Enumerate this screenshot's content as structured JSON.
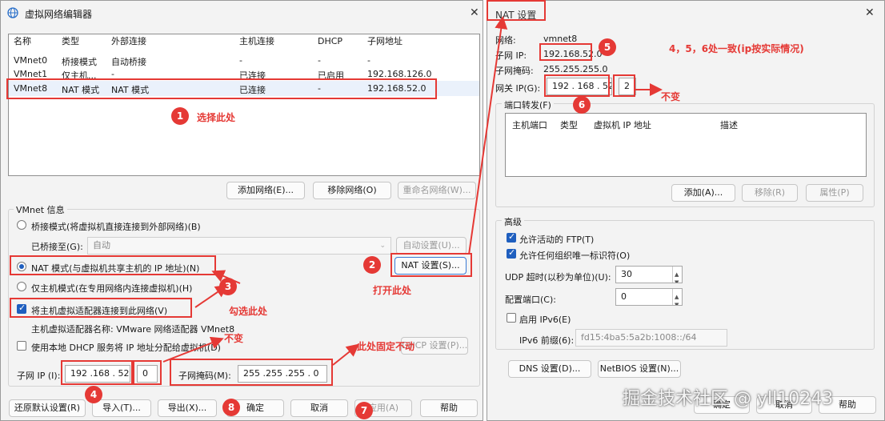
{
  "main_window": {
    "title": "虚拟网络编辑器",
    "close": "✕",
    "table": {
      "columns": [
        "名称",
        "类型",
        "外部连接",
        "主机连接",
        "DHCP",
        "子网地址"
      ],
      "rows": [
        {
          "name": "VMnet0",
          "type": "桥接模式",
          "ext": "自动桥接",
          "host": "-",
          "dhcp": "-",
          "subnet": "-"
        },
        {
          "name": "VMnet1",
          "type": "仅主机...",
          "ext": "-",
          "host": "已连接",
          "dhcp": "已启用",
          "subnet": "192.168.126.0"
        },
        {
          "name": "VMnet8",
          "type": "NAT 模式",
          "ext": "NAT 模式",
          "host": "已连接",
          "dhcp": "-",
          "subnet": "192.168.52.0"
        }
      ]
    },
    "buttons": {
      "add_network": "添加网络(E)...",
      "remove_network": "移除网络(O)",
      "rename_network": "重命名网络(W)...",
      "auto_settings": "自动设置(U)...",
      "nat_settings": "NAT 设置(S)...",
      "dhcp_settings": "DHCP 设置(P)...",
      "restore_defaults": "还原默认设置(R)",
      "import": "导入(T)...",
      "export": "导出(X)...",
      "ok": "确定",
      "cancel": "取消",
      "apply": "应用(A)",
      "help": "帮助"
    },
    "vmnet_info": {
      "legend": "VMnet 信息",
      "bridge_mode": "桥接模式(将虚拟机直接连接到外部网络)(B)",
      "bridged_to_label": "已桥接至(G):",
      "bridged_to_value": "自动",
      "nat_mode": "NAT 模式(与虚拟机共享主机的 IP 地址)(N)",
      "host_only_mode": "仅主机模式(在专用网络内连接虚拟机)(H)",
      "connect_adapter": "将主机虚拟适配器连接到此网络(V)",
      "adapter_name": "主机虚拟适配器名称: VMware 网络适配器 VMnet8",
      "use_dhcp": "使用本地 DHCP 服务将 IP 地址分配给虚拟机(D)",
      "subnet_ip_label": "子网 IP (I):",
      "subnet_ip_value": "192 .168 . 52",
      "subnet_ip_last": "0",
      "subnet_mask_label": "子网掩码(M):",
      "subnet_mask_value": "255 .255 .255 .  0"
    }
  },
  "nat_dialog": {
    "title": "NAT 设置",
    "close": "✕",
    "network_label": "网络:",
    "network_value": "vmnet8",
    "subnet_ip_label": "子网 IP:",
    "subnet_ip_value": "192.168.52.0",
    "subnet_mask_label": "子网掩码:",
    "subnet_mask_value": "255.255.255.0",
    "gateway_label": "网关 IP(G):",
    "gateway_value": "192 . 168 . 52",
    "gateway_last": "2",
    "port_forward_legend": "端口转发(F)",
    "port_columns": [
      "主机端口",
      "类型",
      "虚拟机 IP 地址",
      "描述"
    ],
    "buttons": {
      "add": "添加(A)...",
      "remove": "移除(R)",
      "properties": "属性(P)",
      "dns": "DNS 设置(D)...",
      "netbios": "NetBIOS 设置(N)...",
      "ok": "确定",
      "cancel": "取消",
      "help": "帮助"
    },
    "advanced_legend": "高级",
    "allow_ftp": "允许活动的 FTP(T)",
    "allow_uuid": "允许任何组织唯一标识符(O)",
    "udp_timeout_label": "UDP 超时(以秒为单位)(U):",
    "udp_timeout_value": "30",
    "config_port_label": "配置端口(C):",
    "config_port_value": "0",
    "enable_ipv6": "启用 IPv6(E)",
    "ipv6_prefix_label": "IPv6 前缀(6):",
    "ipv6_prefix_value": "fd15:4ba5:5a2b:1008::/64"
  },
  "annotations": {
    "b1": "1",
    "b2": "2",
    "b3": "3",
    "b4": "4",
    "b5": "5",
    "b6": "6",
    "b7": "7",
    "b8": "8",
    "select_here": "选择此处",
    "open_here": "打开此处",
    "check_here": "勾选此处",
    "unchanged_1": "不变",
    "unchanged_2": "不变",
    "fixed_here": "此处固定不动",
    "consistent": "4，5，6处一致(ip按实际情况)"
  },
  "watermark": "掘金技术社区 @ yll10243",
  "colors": {
    "annotation_red": "#e53935",
    "checkbox_blue": "#1f5fbf"
  }
}
